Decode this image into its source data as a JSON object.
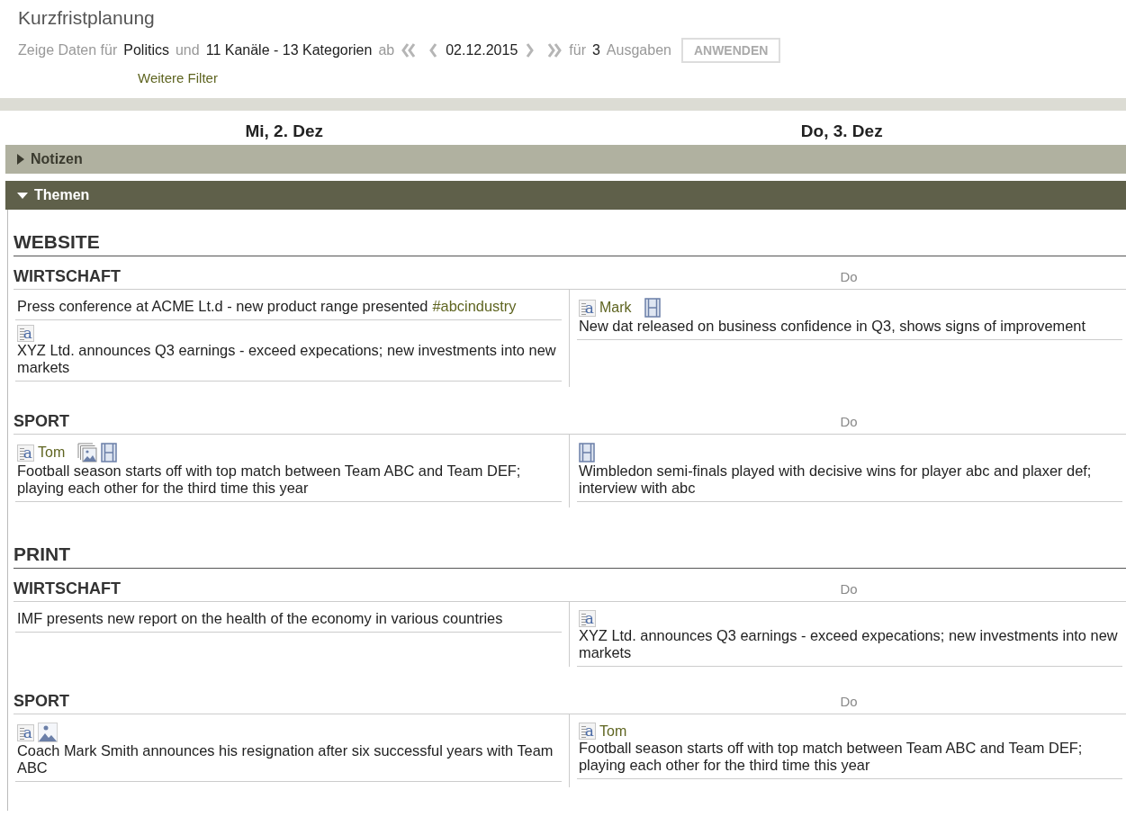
{
  "title": "Kurzfristplanung",
  "filter": {
    "label_show": "Zeige Daten für",
    "topic": "Politics",
    "label_and": "und",
    "channels": "11 Kanäle - 13 Kategorien",
    "label_from": "ab",
    "date": "02.12.2015",
    "label_for": "für",
    "count": "3",
    "label_issues": "Ausgaben",
    "apply": "ANWENDEN",
    "more": "Weitere Filter"
  },
  "days": [
    "Mi, 2. Dez",
    "Do, 3. Dez"
  ],
  "panels": [
    {
      "title": "Notizen",
      "expanded": false
    },
    {
      "title": "Themen",
      "expanded": true
    }
  ],
  "sections": [
    {
      "title": "WEBSITE",
      "categories": [
        {
          "title": "WIRTSCHAFT",
          "day_label": "Do",
          "columns": [
            [
              {
                "text": "Press conference at ACME Lt.d - new product range presented",
                "tag": "#abcindustry"
              },
              {
                "media": [
                  {
                    "kind": "text",
                    "glyph": "a"
                  }
                ],
                "text": "XYZ Ltd. announces Q3 earnings - exceed expecations; new investments into new markets"
              }
            ],
            [
              {
                "media": [
                  {
                    "kind": "text",
                    "glyph": "a"
                  },
                  {
                    "kind": "video"
                  }
                ],
                "author": "Mark",
                "text": "New dat released on business confidence in Q3, shows signs of improvement"
              }
            ]
          ]
        },
        {
          "title": "SPORT",
          "day_label": "Do",
          "columns": [
            [
              {
                "media": [
                  {
                    "kind": "text",
                    "glyph": "a"
                  },
                  {
                    "kind": "gallery"
                  },
                  {
                    "kind": "video"
                  }
                ],
                "author": "Tom",
                "text": "Football season starts off with top match between Team ABC and Team DEF; playing each other for the third time this year"
              }
            ],
            [
              {
                "media": [
                  {
                    "kind": "video"
                  }
                ],
                "text": "Wimbledon semi-finals played with decisive wins for player abc and plaxer def; interview with abc"
              }
            ]
          ]
        }
      ]
    },
    {
      "title": "PRINT",
      "categories": [
        {
          "title": "WIRTSCHAFT",
          "day_label": "Do",
          "columns": [
            [
              {
                "text": "IMF presents new report on the health of the economy in various countries"
              }
            ],
            [
              {
                "media": [
                  {
                    "kind": "text",
                    "glyph": "a"
                  }
                ],
                "text": "XYZ Ltd. announces Q3 earnings - exceed expecations; new investments into new markets"
              }
            ]
          ]
        },
        {
          "title": "SPORT",
          "day_label": "Do",
          "columns": [
            [
              {
                "media": [
                  {
                    "kind": "text",
                    "glyph": "a"
                  },
                  {
                    "kind": "image"
                  }
                ],
                "text": "Coach Mark Smith announces his resignation after six successful years with Team ABC"
              }
            ],
            [
              {
                "media": [
                  {
                    "kind": "text",
                    "glyph": "a"
                  }
                ],
                "author": "Tom",
                "text": "Football season starts off with top match between Team ABC and Team DEF; playing each other for the third time this year"
              }
            ]
          ]
        }
      ]
    }
  ]
}
